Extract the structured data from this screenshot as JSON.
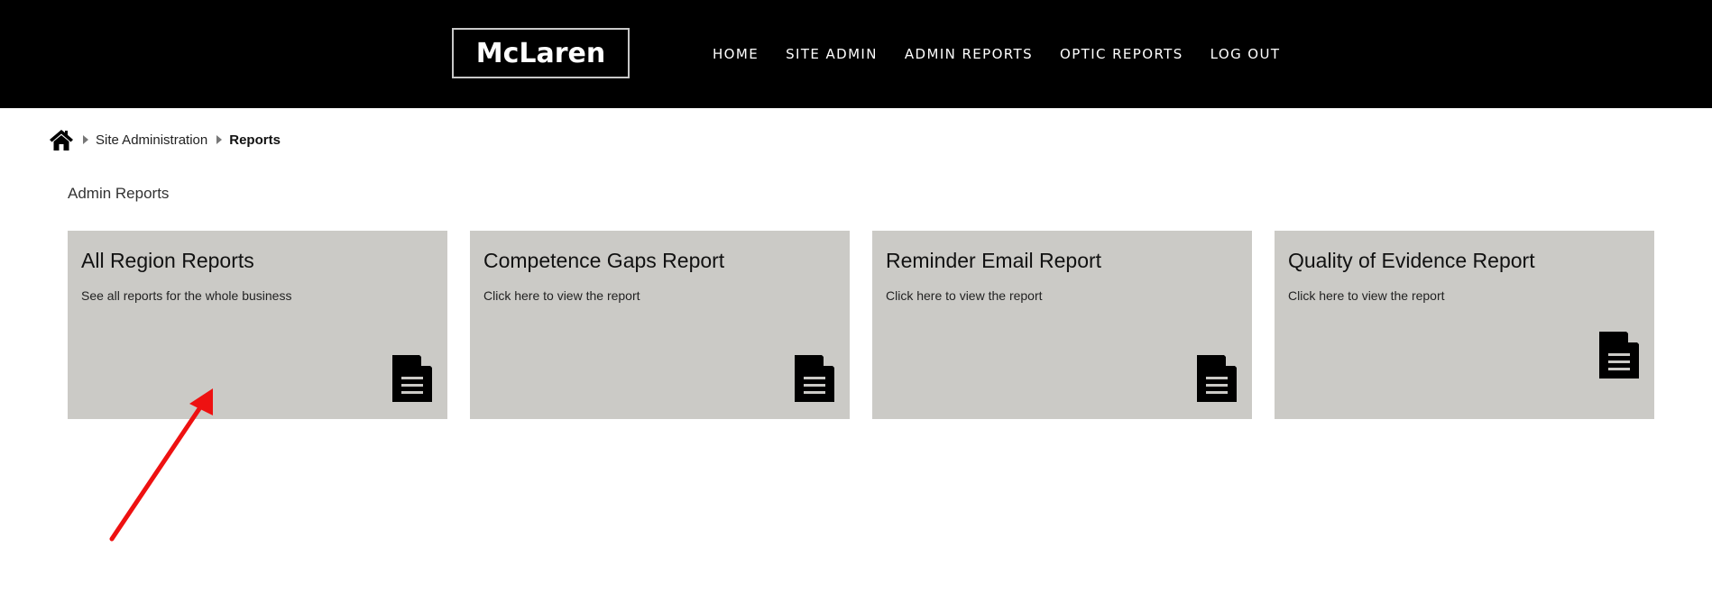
{
  "header": {
    "logo_text": "McLaren",
    "nav": [
      {
        "label": "HOME"
      },
      {
        "label": "SITE ADMIN"
      },
      {
        "label": "ADMIN REPORTS"
      },
      {
        "label": "OPTIC REPORTS"
      },
      {
        "label": "LOG OUT"
      }
    ]
  },
  "breadcrumb": {
    "items": [
      "Site Administration"
    ],
    "current": "Reports"
  },
  "section": {
    "title": "Admin Reports"
  },
  "cards": [
    {
      "title": "All Region Reports",
      "description": "See all reports for the whole business"
    },
    {
      "title": "Competence Gaps Report",
      "description": "Click here to view the report"
    },
    {
      "title": "Reminder Email Report",
      "description": "Click here to view the report"
    },
    {
      "title": "Quality of Evidence Report",
      "description": "Click here to view the report"
    }
  ],
  "colors": {
    "header_bg": "#000000",
    "card_bg": "#cbcac6",
    "annotation_arrow": "#ee1111"
  }
}
